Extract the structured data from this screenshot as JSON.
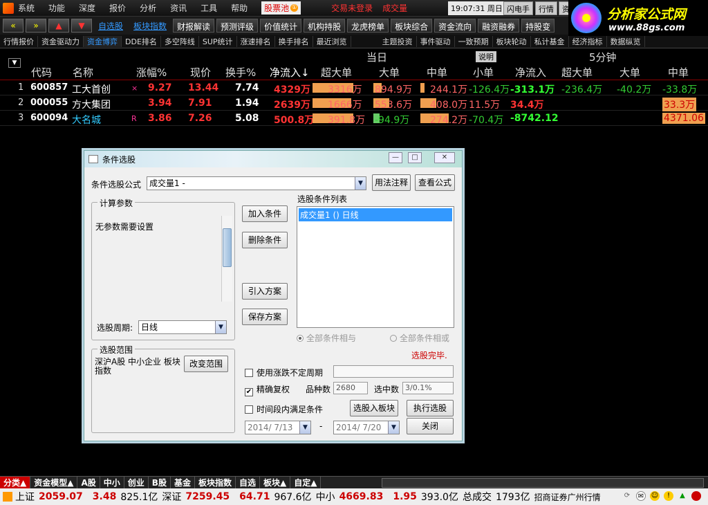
{
  "menu": [
    "系统",
    "功能",
    "深度",
    "报价",
    "分析",
    "资讯",
    "工具",
    "帮助"
  ],
  "stock_pool": {
    "label": "股票池",
    "badge": "①"
  },
  "login_status": "交易未登录",
  "volume_label": "成交量",
  "clock": "19:07:31 周日",
  "top_buttons": [
    "闪电手",
    "行情",
    "资"
  ],
  "brand": {
    "name": "分析家公式网",
    "url": "www.88gs.com"
  },
  "toolbar": {
    "arrows": [
      "«",
      "»",
      "▲",
      "▼"
    ],
    "links": [
      "自选股",
      "板块指数"
    ],
    "buttons": [
      "财报解读",
      "预测评级",
      "价值统计",
      "机构持股",
      "龙虎榜单",
      "板块综合",
      "资金流向",
      "融资融券",
      "持股变"
    ]
  },
  "tabs": [
    "行情报价",
    "资金驱动力",
    "资金博弈",
    "DDE排名",
    "多空阵线",
    "SUP统计",
    "涨速排名",
    "换手排名",
    "最近浏览",
    "主题投资",
    "事件驱动",
    "一致预期",
    "板块轮动",
    "私计基金",
    "经济指标",
    "数据纵览"
  ],
  "active_tab": "资金博弈",
  "header_groups": {
    "today": "当日",
    "note": "说明",
    "five_min": "5分钟"
  },
  "columns": [
    "代码",
    "名称",
    "涨幅%",
    "现价",
    "换手%",
    "净流入↓",
    "超大单",
    "大单",
    "中单",
    "小单",
    "净流入",
    "超大单",
    "大单",
    "中单"
  ],
  "rows": [
    {
      "idx": "1",
      "code": "600857",
      "name": "工大首创",
      "flag": "×",
      "chg": "9.27",
      "price": "13.44",
      "turnover": "7.74",
      "net": "4329万",
      "xl": "3316万",
      "xl_f": 0.9,
      "l": "894.9万",
      "l_f": 0.25,
      "m": "244.1万",
      "m_f": 0.1,
      "s": "-126.4万",
      "net5": "-313.1万",
      "xl5": "-236.4万",
      "l5": "-40.2万",
      "m5": "-33.8万"
    },
    {
      "idx": "2",
      "code": "000055",
      "name": "方大集团",
      "flag": "",
      "chg": "3.94",
      "price": "7.91",
      "turnover": "1.94",
      "net": "2639万",
      "xl": "1666万",
      "xl_f": 0.85,
      "l": "553.6万",
      "l_f": 0.5,
      "m": "408.0万",
      "m_f": 0.4,
      "s": "11.5万",
      "net5": "34.4万",
      "xl5": "",
      "l5": "",
      "m5": "33.3万"
    },
    {
      "idx": "3",
      "code": "600094",
      "name": "大名城",
      "flag": "R",
      "chg": "3.86",
      "price": "7.26",
      "turnover": "5.08",
      "net": "500.8万",
      "xl": "391.8万",
      "xl_f": 0.9,
      "l": "-94.9万",
      "l_f": 0.2,
      "m": "274.2万",
      "m_f": 0.7,
      "s": "-70.4万",
      "net5": "-8742.12",
      "xl5": "",
      "l5": "",
      "m5": "4371.06"
    }
  ],
  "dialog": {
    "title": "条件选股",
    "formula_label": "条件选股公式",
    "formula_value": "成交量1  -",
    "btn_usage": "用法注释",
    "btn_view": "查看公式",
    "params_group": "计算参数",
    "params_text": "无参数需要设置",
    "period_label": "选股周期:",
    "period_value": "日线",
    "btn_add": "加入条件",
    "btn_delete": "删除条件",
    "btn_import": "引入方案",
    "btn_save": "保存方案",
    "list_label": "选股条件列表",
    "list_items": [
      "成交量1  ()  日线"
    ],
    "radio_and": "全部条件相与",
    "radio_or": "全部条件相或",
    "status": "选股完毕.",
    "scope_group": "选股范围",
    "scope_text": "深沪A股  中小企业  板块指数",
    "btn_scope": "改变范围",
    "chk_period": "使用涨跌不定周期",
    "chk_adjust": "精确复权",
    "count_label": "品种数",
    "count_value": "2680",
    "selected_label": "选中数",
    "selected_value": "3/0.1%",
    "chk_time": "时间段内满足条件",
    "btn_to_block": "选股入板块",
    "btn_run": "执行选股",
    "btn_close": "关闭",
    "date_from": "2014/ 7/13",
    "date_dash": "-",
    "date_to": "2014/ 7/20"
  },
  "bottom_tabs": [
    "分类▲",
    "资金模型▲",
    "A股",
    "中小",
    "创业",
    "B股",
    "基金",
    "板块指数",
    "自选",
    "板块▲",
    "自定▲"
  ],
  "status_bar": {
    "sh_label": "上证",
    "sh_idx": "2059.07",
    "sh_chg": "3.48",
    "sh_amt": "825.1亿",
    "sz_label": "深证",
    "sz_idx": "7259.45",
    "sz_chg": "64.71",
    "sz_amt": "967.6亿",
    "zx_label": "中小",
    "zx_idx": "4669.83",
    "zx_chg": "1.95",
    "zx_amt": "393.0亿",
    "total_label": "总成交",
    "total_amt": "1793亿",
    "broker": "招商证券广州行情"
  }
}
